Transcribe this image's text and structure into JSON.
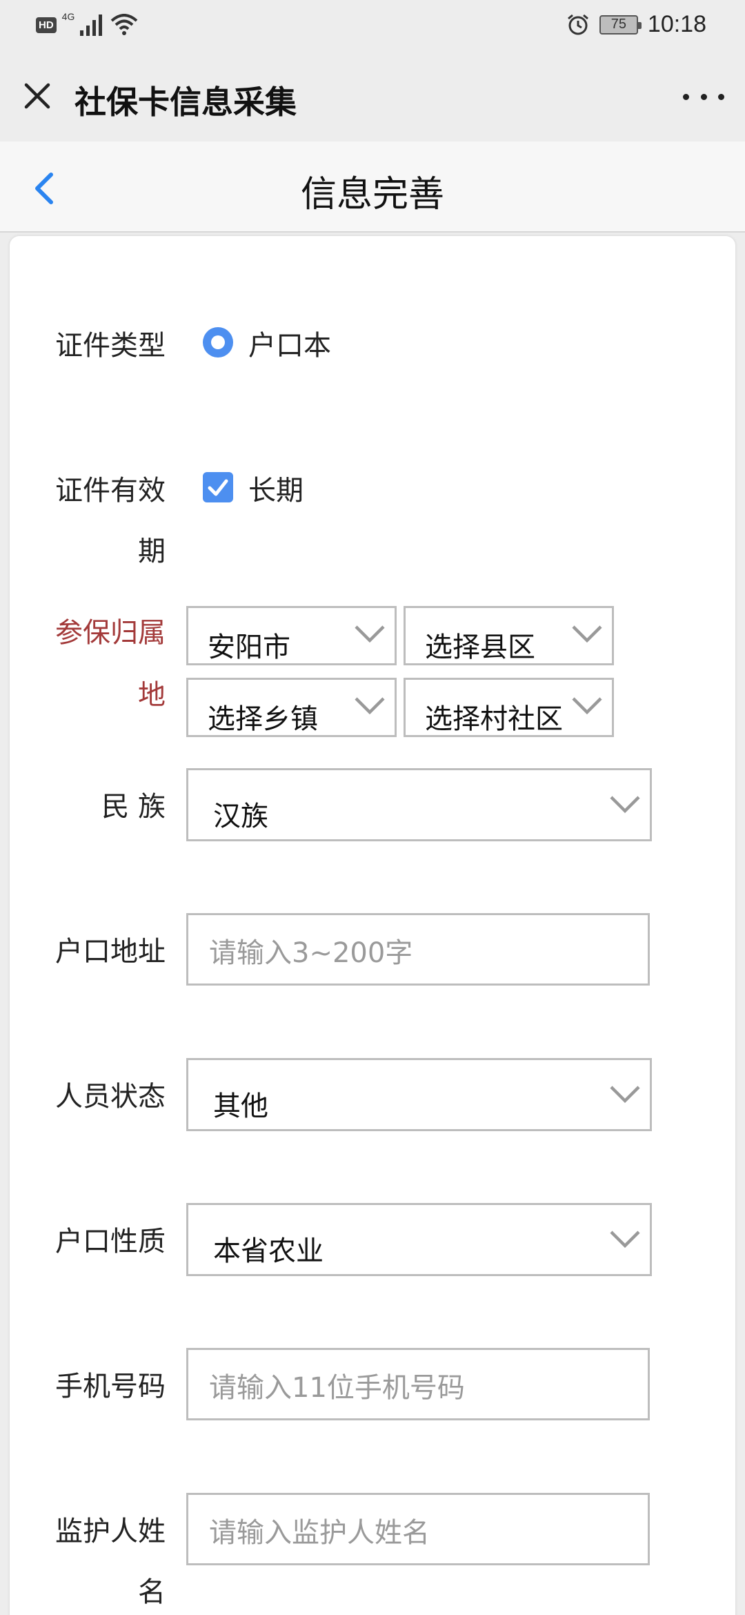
{
  "status": {
    "network": "4G",
    "hd": "HD",
    "battery": "75",
    "time": "10:18"
  },
  "wx": {
    "title": "社保卡信息采集"
  },
  "nav": {
    "title": "信息完善"
  },
  "form": {
    "id_type": {
      "label": "证件类型",
      "option": "户口本"
    },
    "validity": {
      "label1": "证件有效",
      "label2": "期",
      "option": "长期"
    },
    "region": {
      "label1": "参保归属",
      "label2": "地",
      "city": "安阳市",
      "county": "选择县区",
      "town": "选择乡镇",
      "village": "选择村社区"
    },
    "ethnicity": {
      "label": "民  族",
      "value": "汉族"
    },
    "address": {
      "label": "户口地址",
      "placeholder": "请输入3~200字"
    },
    "person_status": {
      "label": "人员状态",
      "value": "其他"
    },
    "hukou_type": {
      "label": "户口性质",
      "value": "本省农业"
    },
    "phone": {
      "label": "手机号码",
      "placeholder": "请输入11位手机号码"
    },
    "guardian": {
      "label1": "监护人姓",
      "label2": "名",
      "placeholder": "请输入监护人姓名"
    }
  },
  "colors": {
    "accent": "#4d8ff0",
    "required_label": "#a33a3a",
    "back_arrow": "#2a84f0"
  }
}
